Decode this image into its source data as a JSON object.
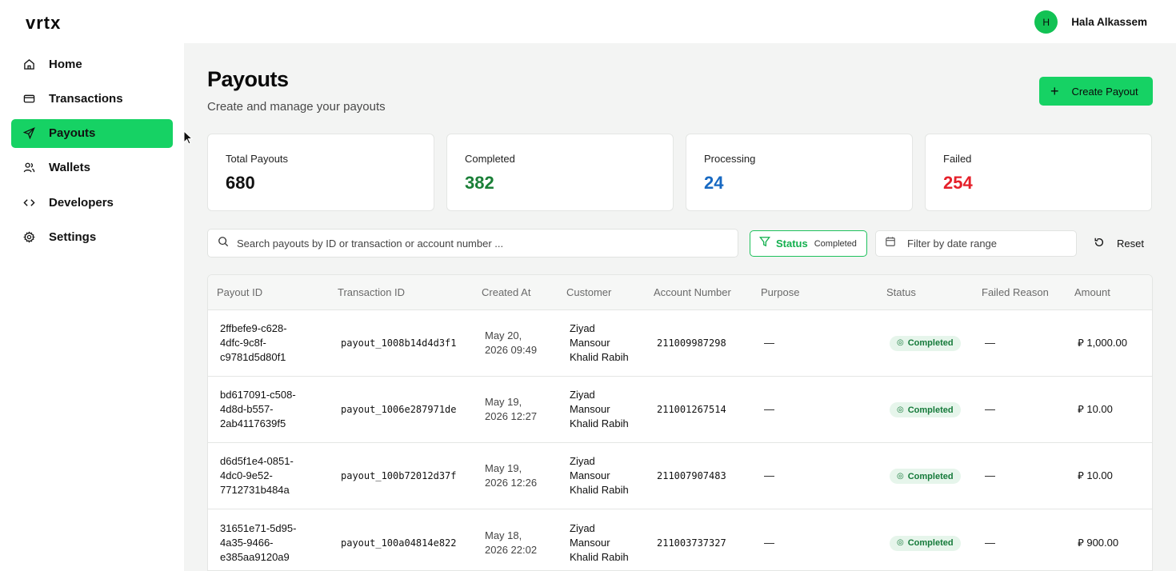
{
  "brand": {
    "logo": "vrtx"
  },
  "user": {
    "initial": "H",
    "name": "Hala Alkassem"
  },
  "nav": [
    {
      "label": "Home",
      "icon": "home-icon",
      "active": false
    },
    {
      "label": "Transactions",
      "icon": "card-icon",
      "active": false
    },
    {
      "label": "Payouts",
      "icon": "send-icon",
      "active": true
    },
    {
      "label": "Wallets",
      "icon": "users-icon",
      "active": false
    },
    {
      "label": "Developers",
      "icon": "code-icon",
      "active": false
    },
    {
      "label": "Settings",
      "icon": "gear-icon",
      "active": false
    }
  ],
  "page": {
    "title": "Payouts",
    "subtitle": "Create and manage your payouts",
    "create_label": "Create Payout"
  },
  "stats": [
    {
      "label": "Total Payouts",
      "value": "680",
      "color": "#111111"
    },
    {
      "label": "Completed",
      "value": "382",
      "color": "#1a7f37"
    },
    {
      "label": "Processing",
      "value": "24",
      "color": "#1769c2"
    },
    {
      "label": "Failed",
      "value": "254",
      "color": "#e5202a"
    }
  ],
  "filters": {
    "search_placeholder": "Search payouts by ID or transaction or account number ...",
    "status_label": "Status",
    "status_value": "Completed",
    "date_placeholder": "Filter by date range",
    "reset_label": "Reset"
  },
  "table": {
    "columns": [
      "Payout ID",
      "Transaction ID",
      "Created At",
      "Customer",
      "Account Number",
      "Purpose",
      "Status",
      "Failed Reason",
      "Amount"
    ],
    "rows": [
      {
        "payout_id": [
          "2ffbefe9-c628-",
          "4dfc-9c8f-",
          "c9781d5d80f1"
        ],
        "txn": "payout_1008b14d4d3f1",
        "created": [
          "May 20,",
          "2026 09:49"
        ],
        "customer": [
          "Ziyad",
          "Mansour",
          "Khalid Rabih"
        ],
        "account": "211009987298",
        "purpose": "—",
        "status": "Completed",
        "failed": "—",
        "amount": "⃁ 1,000.00"
      },
      {
        "payout_id": [
          "bd617091-c508-",
          "4d8d-b557-",
          "2ab4117639f5"
        ],
        "txn": "payout_1006e287971de",
        "created": [
          "May 19,",
          "2026 12:27"
        ],
        "customer": [
          "Ziyad",
          "Mansour",
          "Khalid Rabih"
        ],
        "account": "211001267514",
        "purpose": "—",
        "status": "Completed",
        "failed": "—",
        "amount": "⃁ 10.00"
      },
      {
        "payout_id": [
          "d6d5f1e4-0851-",
          "4dc0-9e52-",
          "7712731b484a"
        ],
        "txn": "payout_100b72012d37f",
        "created": [
          "May 19,",
          "2026 12:26"
        ],
        "customer": [
          "Ziyad",
          "Mansour",
          "Khalid Rabih"
        ],
        "account": "211007907483",
        "purpose": "—",
        "status": "Completed",
        "failed": "—",
        "amount": "⃁ 10.00"
      },
      {
        "payout_id": [
          "31651e71-5d95-",
          "4a35-9466-",
          "e385aa9120a9"
        ],
        "txn": "payout_100a04814e822",
        "created": [
          "May 18,",
          "2026 22:02"
        ],
        "customer": [
          "Ziyad",
          "Mansour",
          "Khalid Rabih"
        ],
        "account": "211003737327",
        "purpose": "—",
        "status": "Completed",
        "failed": "—",
        "amount": "⃁ 900.00"
      }
    ]
  }
}
